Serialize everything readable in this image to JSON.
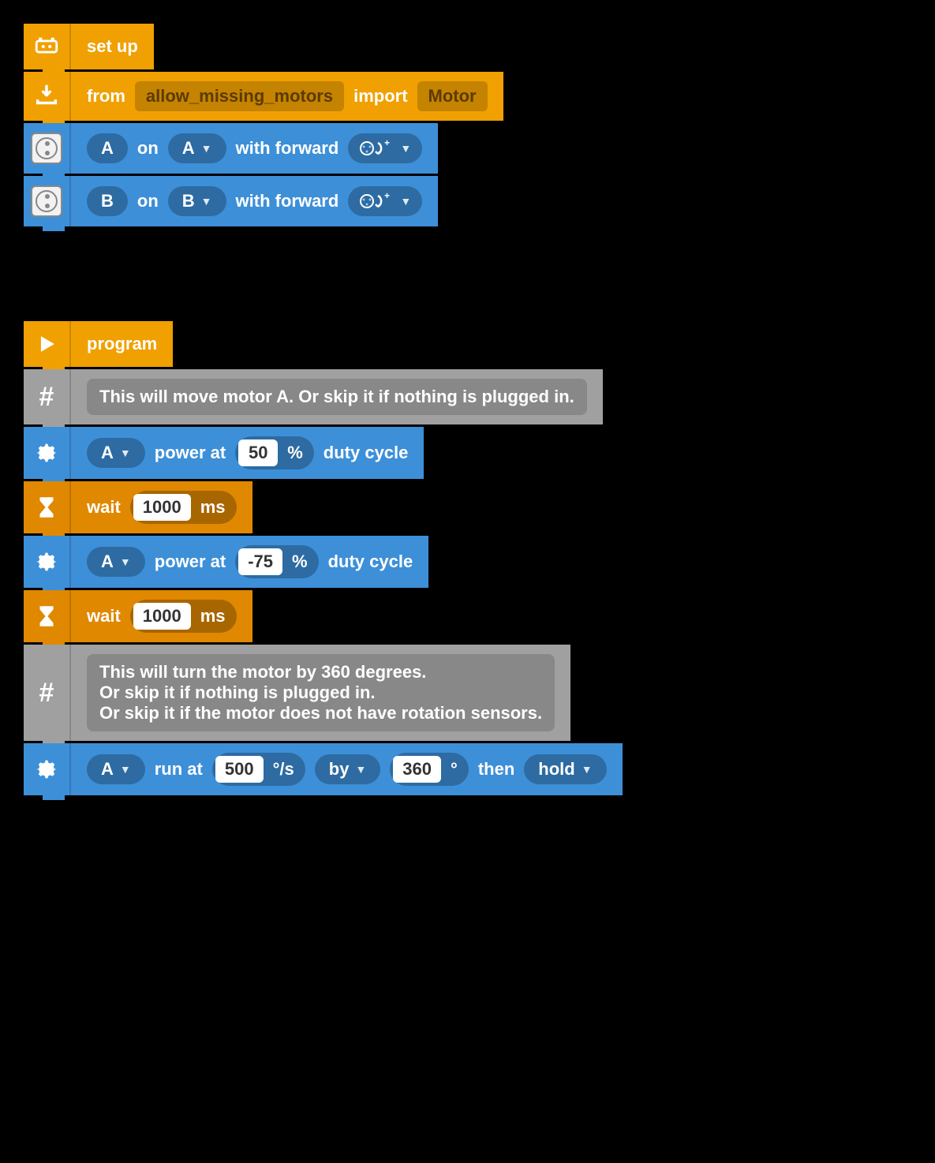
{
  "stack1": {
    "setup": {
      "label": "set up"
    },
    "import": {
      "from": "from",
      "module": "allow_missing_motors",
      "import": "import",
      "class": "Motor"
    },
    "motorA": {
      "var": "A",
      "on": "on",
      "port": "A",
      "withfwd": "with forward"
    },
    "motorB": {
      "var": "B",
      "on": "on",
      "port": "B",
      "withfwd": "with forward"
    }
  },
  "stack2": {
    "program": {
      "label": "program"
    },
    "c1": {
      "text": "This will move motor A. Or skip it if nothing is plugged in."
    },
    "p1": {
      "motor": "A",
      "label1": "power at",
      "val": "50",
      "unit": "%",
      "label2": "duty cycle"
    },
    "w1": {
      "label": "wait",
      "val": "1000",
      "unit": "ms"
    },
    "p2": {
      "motor": "A",
      "label1": "power at",
      "val": "-75",
      "unit": "%",
      "label2": "duty cycle"
    },
    "w2": {
      "label": "wait",
      "val": "1000",
      "unit": "ms"
    },
    "c2": {
      "l1": "This will turn the motor by 360 degrees.",
      "l2": "Or skip it if nothing is plugged in.",
      "l3": "Or skip it if the motor does not have rotation sensors."
    },
    "run": {
      "motor": "A",
      "runat": "run at",
      "speed": "500",
      "speedunit": "°/s",
      "mode": "by",
      "angle": "360",
      "angleunit": "°",
      "then": "then",
      "action": "hold"
    }
  }
}
